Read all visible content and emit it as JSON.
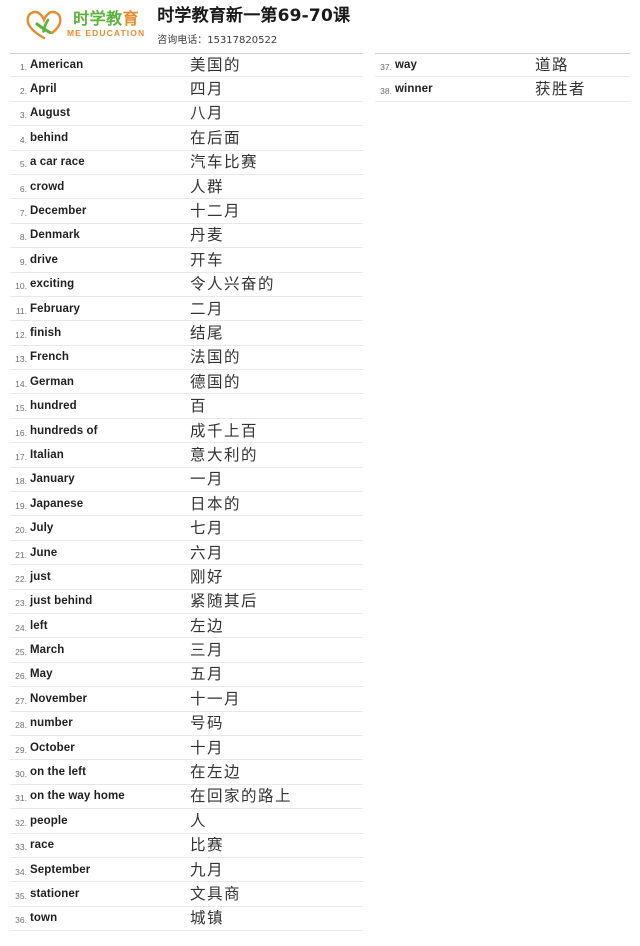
{
  "header": {
    "logo": {
      "mark_icon": "heart-leaf-icon",
      "cn_green": "时学教",
      "cn_orange": "育",
      "en": "ME EDUCATION",
      "green": "#5BB33A",
      "orange": "#E88B2E"
    },
    "title": "时学教育新一第69-70课",
    "phone": "咨询电话：15317820522"
  },
  "vocabulary": {
    "left": [
      {
        "num": "1.",
        "en": "American",
        "cn": "美国的"
      },
      {
        "num": "2.",
        "en": "April",
        "cn": "四月"
      },
      {
        "num": "3.",
        "en": "August",
        "cn": "八月"
      },
      {
        "num": "4.",
        "en": "behind",
        "cn": "在后面"
      },
      {
        "num": "5.",
        "en": "a car race",
        "cn": "汽车比赛"
      },
      {
        "num": "6.",
        "en": "crowd",
        "cn": "人群"
      },
      {
        "num": "7.",
        "en": "December",
        "cn": "十二月"
      },
      {
        "num": "8.",
        "en": "Denmark",
        "cn": "丹麦"
      },
      {
        "num": "9.",
        "en": "drive",
        "cn": "开车"
      },
      {
        "num": "10.",
        "en": "exciting",
        "cn": "令人兴奋的"
      },
      {
        "num": "11.",
        "en": "February",
        "cn": "二月"
      },
      {
        "num": "12.",
        "en": "finish",
        "cn": "结尾"
      },
      {
        "num": "13.",
        "en": "French",
        "cn": "法国的"
      },
      {
        "num": "14.",
        "en": "German",
        "cn": "德国的"
      },
      {
        "num": "15.",
        "en": "hundred",
        "cn": "百"
      },
      {
        "num": "16.",
        "en": "hundreds of",
        "cn": "成千上百"
      },
      {
        "num": "17.",
        "en": "Italian",
        "cn": "意大利的"
      },
      {
        "num": "18.",
        "en": "January",
        "cn": "一月"
      },
      {
        "num": "19.",
        "en": "Japanese",
        "cn": "日本的"
      },
      {
        "num": "20.",
        "en": "July",
        "cn": "七月"
      },
      {
        "num": "21.",
        "en": "June",
        "cn": "六月"
      },
      {
        "num": "22.",
        "en": "just",
        "cn": "刚好"
      },
      {
        "num": "23.",
        "en": "just behind",
        "cn": "紧随其后"
      },
      {
        "num": "24.",
        "en": "left",
        "cn": "左边"
      },
      {
        "num": "25.",
        "en": "March",
        "cn": "三月"
      },
      {
        "num": "26.",
        "en": "May",
        "cn": "五月"
      },
      {
        "num": "27.",
        "en": "November",
        "cn": "十一月"
      },
      {
        "num": "28.",
        "en": "number",
        "cn": "号码"
      },
      {
        "num": "29.",
        "en": "October",
        "cn": "十月"
      },
      {
        "num": "30.",
        "en": "on the left",
        "cn": "在左边"
      },
      {
        "num": "31.",
        "en": "on the way home",
        "cn": "在回家的路上"
      },
      {
        "num": "32.",
        "en": "people",
        "cn": "人"
      },
      {
        "num": "33.",
        "en": "race",
        "cn": "比赛"
      },
      {
        "num": "34.",
        "en": "September",
        "cn": "九月"
      },
      {
        "num": "35.",
        "en": "stationer",
        "cn": "文具商"
      },
      {
        "num": "36.",
        "en": "town",
        "cn": "城镇"
      }
    ],
    "right": [
      {
        "num": "37.",
        "en": "way",
        "cn": "道路"
      },
      {
        "num": "38.",
        "en": "winner",
        "cn": "获胜者"
      }
    ]
  }
}
